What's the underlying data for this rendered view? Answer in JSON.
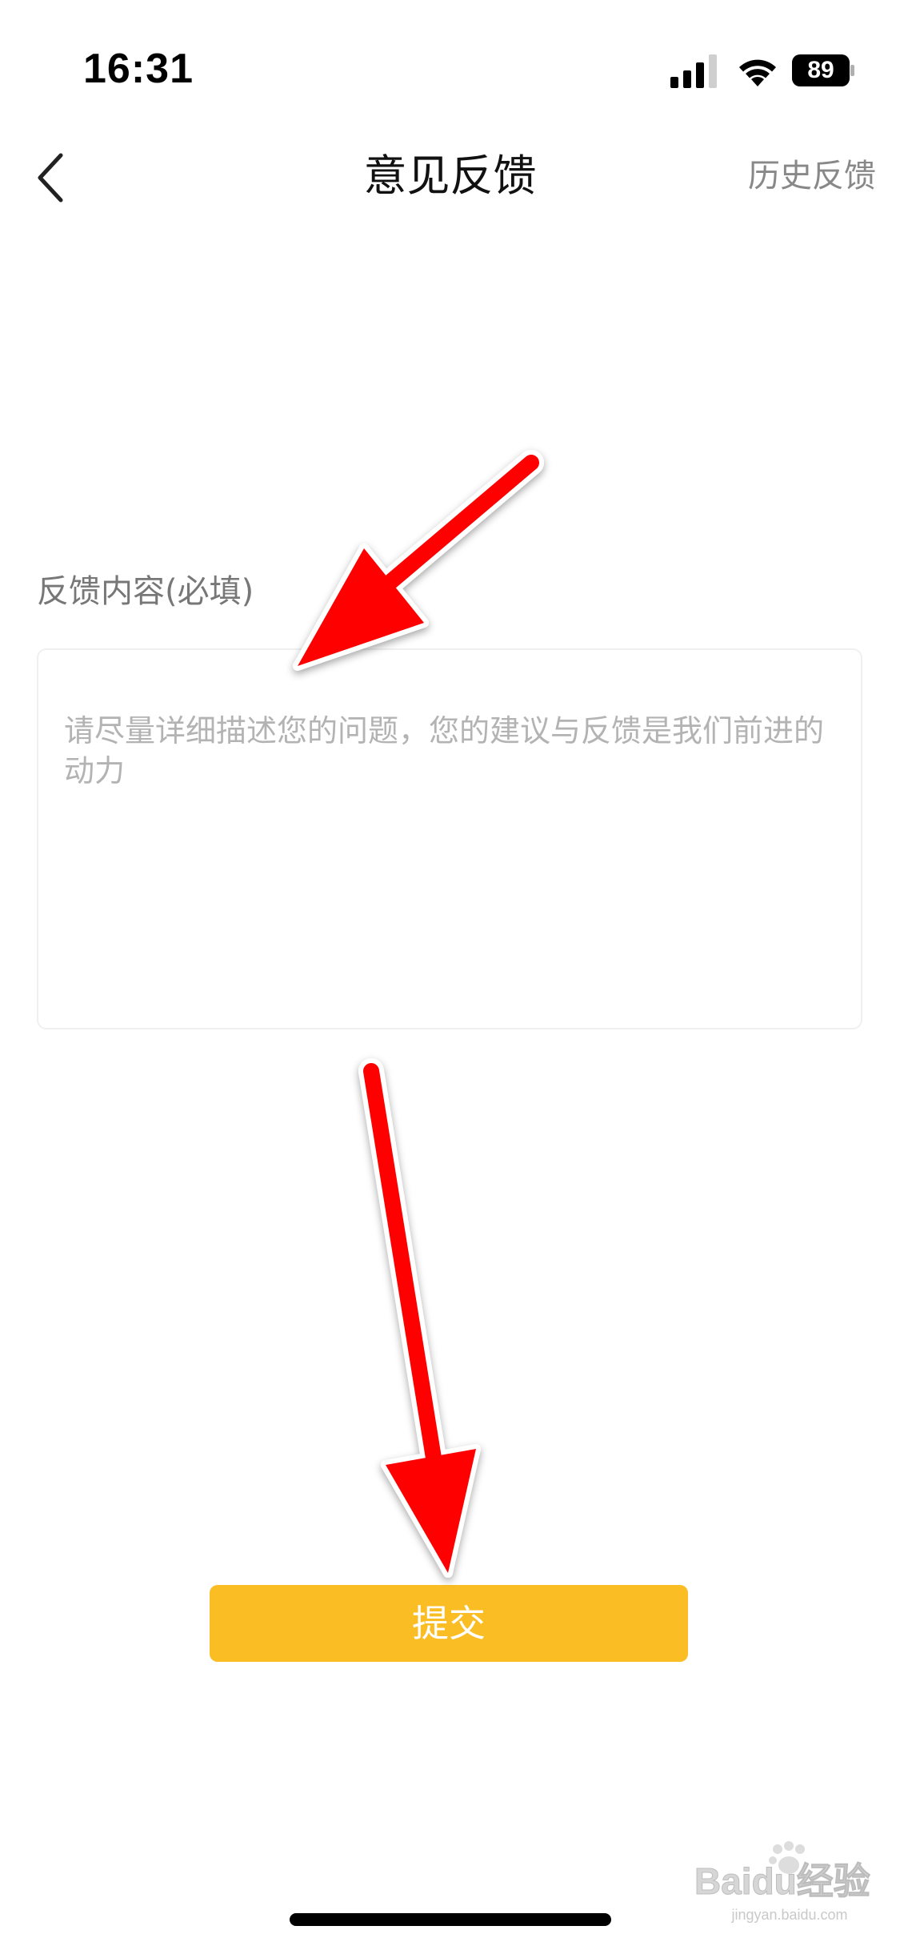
{
  "status_bar": {
    "time": "16:31",
    "battery_level": "89"
  },
  "nav": {
    "title": "意见反馈",
    "history_label": "历史反馈"
  },
  "form": {
    "label": "反馈内容(必填)",
    "placeholder": "请尽量详细描述您的问题，您的建议与反馈是我们前进的动力",
    "value": ""
  },
  "submit": {
    "label": "提交",
    "color": "#fbbd24"
  },
  "annotations": {
    "arrow_color": "#ff0000",
    "count": 2
  },
  "watermark": {
    "brand": "Baidu经验",
    "url": "jingyan.baidu.com"
  },
  "icons": {
    "back": "chevron-left-icon",
    "signal": "cellular-signal-icon",
    "wifi": "wifi-icon",
    "battery": "battery-icon"
  }
}
